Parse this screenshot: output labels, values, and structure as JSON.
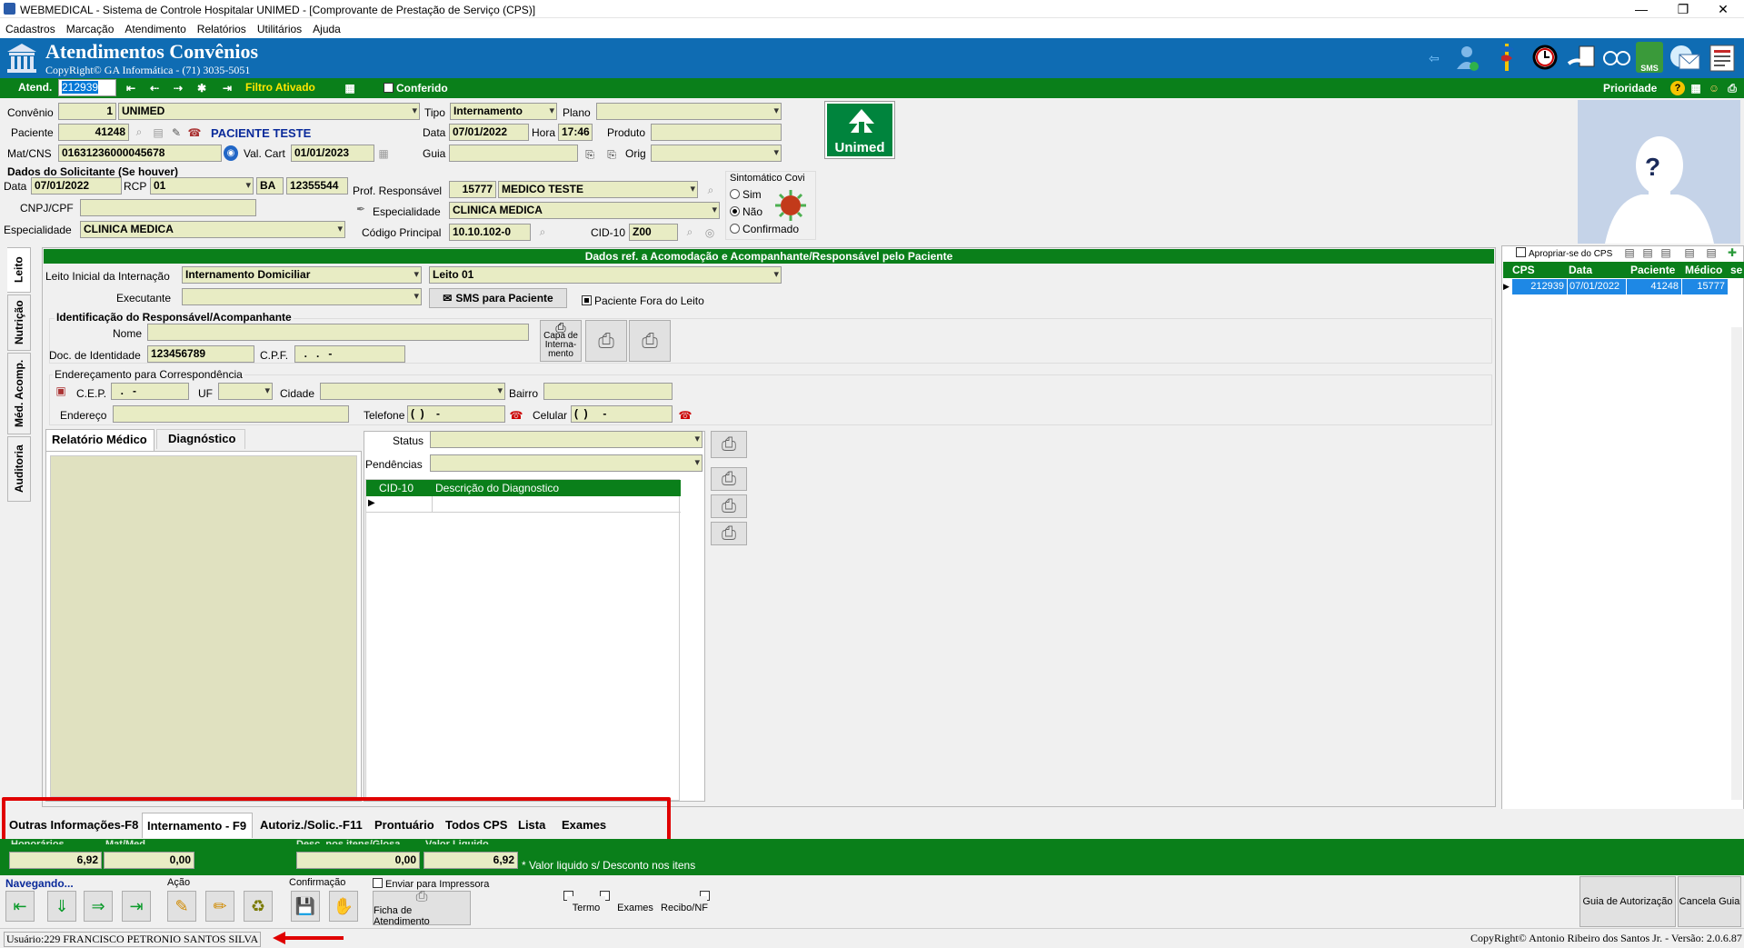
{
  "window": {
    "title": "WEBMEDICAL - Sistema de Controle Hospitalar UNIMED - [Comprovante de Prestação de Serviço  (CPS)]",
    "minimize_glyph": "—",
    "restore_glyph": "❐",
    "close_glyph": "✕"
  },
  "menu": [
    "Cadastros",
    "Marcação",
    "Atendimento",
    "Relatórios",
    "Utilitários",
    "Ajuda"
  ],
  "header": {
    "title": "Atendimentos Convênios",
    "copyright": "CopyRight© GA Informática - (71) 3035-5051",
    "sms_badge": "SMS"
  },
  "atend_bar": {
    "atend_label": "Atend.",
    "atend_value": "212939",
    "filtro": "Filtro Ativado",
    "conferido": "Conferido",
    "prioridade": "Prioridade",
    "help": "?"
  },
  "form": {
    "convenio_label": "Convênio",
    "convenio_code": "1",
    "convenio_name": "UNIMED",
    "tipo_label": "Tipo",
    "tipo_value": "Internamento",
    "plano_label": "Plano",
    "plano_value": "",
    "paciente_label": "Paciente",
    "paciente_code": "41248",
    "paciente_name": "PACIENTE TESTE",
    "data_label": "Data",
    "data_value": "07/01/2022",
    "hora_label": "Hora",
    "hora_value": "17:46",
    "produto_label": "Produto",
    "produto_value": "",
    "matcns_label": "Mat/CNS",
    "matcns_value": "01631236000045678",
    "valcart_label": "Val. Cart",
    "valcart_value": "01/01/2023",
    "guia_label": "Guia",
    "guia_value": "",
    "orig_label": "Orig",
    "orig_value": "",
    "logo_text": "Unimed",
    "photo_placeholder": "?"
  },
  "solicitante": {
    "section": "Dados do Solicitante (Se houver)",
    "data_label": "Data",
    "data_value": "07/01/2022",
    "rcp_label": "RCP",
    "rcp_value": "01",
    "uf_value": "BA",
    "num_value": "12355544",
    "cnpj_label": "CNPJ/CPF",
    "cnpj_value": "",
    "especialidade_label": "Especialidade",
    "especialidade_value": "CLINICA MEDICA"
  },
  "profissional": {
    "prof_label": "Prof. Responsável",
    "prof_code": "15777",
    "prof_name": "MEDICO TESTE",
    "esp_label": "Especialidade",
    "esp_value": "CLINICA MEDICA",
    "codigo_label": "Código Principal",
    "codigo_value": "10.10.102-0",
    "cid_label": "CID-10",
    "cid_value": "Z00"
  },
  "covid": {
    "title": "Sintomático Covi",
    "options": [
      "Sim",
      "Não",
      "Confirmado"
    ],
    "selected": "Não"
  },
  "vertical_tabs": [
    "Leito",
    "Nutrição",
    "Méd. Acomp.",
    "Auditoria"
  ],
  "acomodacao": {
    "header": "Dados ref. a  Acomodação e Acompanhante/Responsável pelo Paciente",
    "leito_inicial_label": "Leito Inicial da Internação",
    "leito_inicial_value": "Internamento Domiciliar",
    "leito_value": "Leito 01",
    "executante_label": "Executante",
    "executante_value": "",
    "sms_button": "SMS para Paciente",
    "fora_leito": "Paciente Fora do Leito",
    "ident_section": "Identificação do Responsável/Acompanhante",
    "nome_label": "Nome",
    "nome_value": "",
    "doc_label": "Doc. de Identidade",
    "doc_value": "123456789",
    "cpf_label": "C.P.F.",
    "cpf_value": "  .   .   -",
    "capa_label": "Capa de Interna-mento",
    "end_section": "Endereçamento para Correspondência",
    "cep_label": "C.E.P.",
    "cep_value": "  .   -",
    "uf_label": "UF",
    "cidade_label": "Cidade",
    "bairro_label": "Bairro",
    "endereco_label": "Endereço",
    "telefone_label": "Telefone",
    "telefone_value": "(  )    -",
    "celular_label": "Celular",
    "celular_value": "(  )     -"
  },
  "relatorio": {
    "tabs": [
      "Relatório Médico",
      "Diagnóstico"
    ],
    "status_label": "Status",
    "pendencias_label": "Pendências",
    "grid_cols": [
      "CID-10",
      "Descrição do Diagnostico"
    ]
  },
  "right_panel": {
    "apropriar": "Apropriar-se do CPS",
    "columns": [
      "CPS",
      "Data",
      "Paciente",
      "Médico",
      "se"
    ],
    "rows": [
      {
        "cps": "212939",
        "data": "07/01/2022",
        "paciente": "41248",
        "medico": "15777"
      }
    ]
  },
  "bottom_tabs": [
    "Outras Informações-F8",
    "Internamento - F9",
    "Autoriz./Solic.-F11",
    "Prontuário",
    "Todos CPS",
    "Lista",
    "Exames"
  ],
  "totals": {
    "honorarios_label": "Honorários",
    "honorarios_value": "6,92",
    "matmed_label": "Mat/Med",
    "matmed_value": "0,00",
    "desc_label": "Desc. nos itens/Glosa",
    "desc_value": "0,00",
    "liquido_label": "Valor Liquido",
    "liquido_value": "6,92",
    "liquido_note": "* Valor liquido s/ Desconto nos itens"
  },
  "toolbar": {
    "navegando": "Navegando...",
    "acao": "Ação",
    "confirmacao": "Confirmação",
    "enviar_impressora": "Enviar para Impressora",
    "ficha": "Ficha de Atendimento",
    "termo": "Termo",
    "exames": "Exames",
    "recibo": "Recibo/NF",
    "guia_autorizacao": "Guia de Autorização",
    "cancela_guia": "Cancela Guia"
  },
  "status_bar": {
    "usuario": "Usuário:229 FRANCISCO PETRONIO SANTOS SILVA",
    "copyright": "CopyRight© Antonio Ribeiro dos Santos Jr. - Versão: 2.0.6.87"
  },
  "colors": {
    "header_blue": "#0f6cb3",
    "bar_green": "#0a7f1a",
    "field_beige": "#e8ecc4",
    "highlight_red": "#e00000",
    "selection_blue": "#1e88e5"
  }
}
